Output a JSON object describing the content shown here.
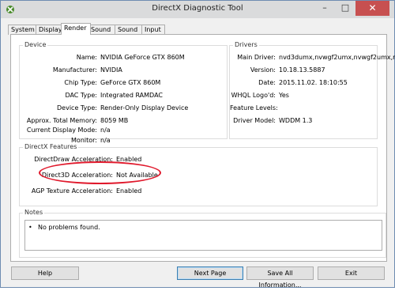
{
  "window": {
    "title": "DirectX Diagnostic Tool",
    "minimize_glyph": "–",
    "maximize_glyph": "□",
    "close_glyph": "✕",
    "accent": "#c75050"
  },
  "tabs": [
    "System",
    "Display",
    "Render",
    "Sound 1",
    "Sound 2",
    "Input"
  ],
  "active_tab": "Render",
  "device": {
    "title": "Device",
    "rows": [
      {
        "label": "Name:",
        "value": "NVIDIA GeForce GTX 860M"
      },
      {
        "label": "Manufacturer:",
        "value": "NVIDIA"
      },
      {
        "label": "Chip Type:",
        "value": "GeForce GTX 860M"
      },
      {
        "label": "DAC Type:",
        "value": "Integrated RAMDAC"
      },
      {
        "label": "Device Type:",
        "value": "Render-Only Display Device"
      },
      {
        "label": "Approx. Total Memory:",
        "value": "8059 MB"
      },
      {
        "label": "Current Display Mode:",
        "value": "n/a"
      },
      {
        "label": "Monitor:",
        "value": "n/a"
      }
    ]
  },
  "drivers": {
    "title": "Drivers",
    "rows": [
      {
        "label": "Main Driver:",
        "value": "nvd3dumx,nvwgf2umx,nvwgf2umx,r"
      },
      {
        "label": "Version:",
        "value": "10.18.13.5887"
      },
      {
        "label": "Date:",
        "value": "2015.11.02.  18:10:55"
      },
      {
        "label": "WHQL Logo'd:",
        "value": "Yes"
      },
      {
        "label": "Feature Levels:",
        "value": ""
      },
      {
        "label": "Driver Model:",
        "value": "WDDM 1.3"
      }
    ]
  },
  "features": {
    "title": "DirectX Features",
    "rows": [
      {
        "label": "DirectDraw Acceleration:",
        "value": "Enabled"
      },
      {
        "label": "Direct3D Acceleration:",
        "value": "Not Available"
      },
      {
        "label": "AGP Texture Acceleration:",
        "value": "Enabled"
      }
    ],
    "highlight_color": "#e0192c"
  },
  "notes": {
    "title": "Notes",
    "bullet": "•",
    "items": [
      "No problems found."
    ]
  },
  "buttons": {
    "help": "Help",
    "next_page": "Next Page",
    "save_all": "Save All Information...",
    "exit": "Exit"
  },
  "icons": {
    "app": "directx-icon"
  }
}
